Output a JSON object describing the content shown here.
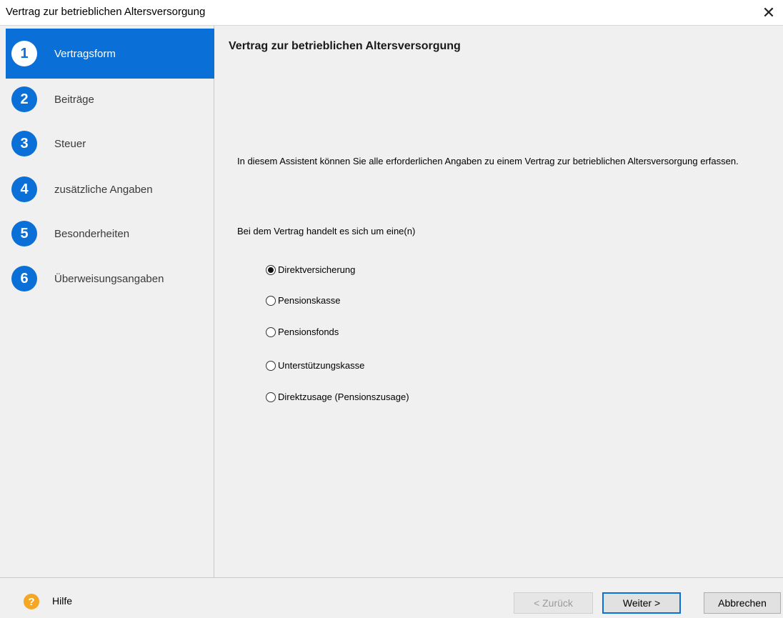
{
  "window": {
    "title": "Vertrag zur betrieblichen Altersversorgung",
    "close_glyph": "✕"
  },
  "sidebar": {
    "steps": [
      {
        "number": "1",
        "label": "Vertragsform",
        "active": true
      },
      {
        "number": "2",
        "label": "Beiträge"
      },
      {
        "number": "3",
        "label": "Steuer"
      },
      {
        "number": "4",
        "label": "zusätzliche Angaben"
      },
      {
        "number": "5",
        "label": "Besonderheiten"
      },
      {
        "number": "6",
        "label": "Überweisungsangaben"
      }
    ]
  },
  "main": {
    "heading": "Vertrag zur betrieblichen Altersversorgung",
    "intro": "In diesem Assistent können Sie alle erforderlichen Angaben zu einem Vertrag zur betrieblichen Altersversorgung erfassen.",
    "question": "Bei dem Vertrag handelt es sich um eine(n)",
    "options": [
      {
        "label": "Direktversicherung",
        "checked": true
      },
      {
        "label": "Pensionskasse",
        "checked": false
      },
      {
        "label": "Pensionsfonds",
        "checked": false
      },
      {
        "label": "Unterstützungskasse",
        "checked": false
      },
      {
        "label": "Direktzusage (Pensionszusage)",
        "checked": false
      }
    ]
  },
  "footer": {
    "help_icon": "?",
    "help_label": "Hilfe",
    "back_label": "< Zurück",
    "next_label": "Weiter >",
    "cancel_label": "Abbrechen"
  },
  "colors": {
    "accent": "#0a6fd6",
    "help": "#f5a623"
  }
}
